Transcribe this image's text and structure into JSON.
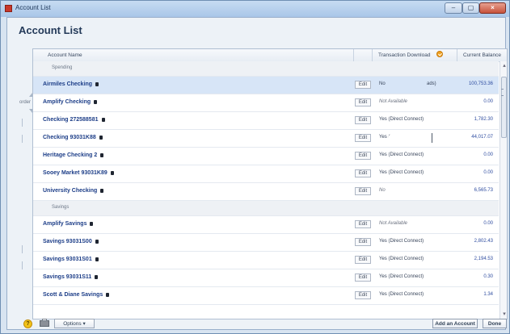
{
  "window": {
    "title": "Account List"
  },
  "page": {
    "title": "Account List"
  },
  "table": {
    "headers": {
      "name": "Account Name",
      "download": "Transaction Download",
      "balance": "Current Balance"
    },
    "edit_label": "Edit",
    "groups": [
      {
        "label": "Spending",
        "rows": [
          {
            "name": "Airmiles Checking",
            "download": "No",
            "download_extra": "ads)",
            "balance": "100,753.36",
            "selected": true
          },
          {
            "name": "Amplify Checking",
            "download": "Not Available",
            "balance": "0.00",
            "muted": true
          },
          {
            "name": "Checking 272588581",
            "download": "Yes (Direct Connect)",
            "balance": "1,782.30"
          },
          {
            "name": "Checking 93031K88",
            "download": "Yes (",
            "balance": "44,017.07",
            "cursor": true
          },
          {
            "name": "Heritage Checking 2",
            "download": "Yes (Direct Connect)",
            "balance": "0.00"
          },
          {
            "name": "Sooey Market 93031K89",
            "download": "Yes (Direct Connect)",
            "balance": "0.00"
          },
          {
            "name": "University Checking",
            "download": "No",
            "balance": "6,565.73",
            "muted": true
          }
        ]
      },
      {
        "label": "Savings",
        "rows": [
          {
            "name": "Amplify Savings",
            "download": "Not Available",
            "balance": "0.00",
            "muted": true
          },
          {
            "name": "Savings 93031S00",
            "download": "Yes (Direct Connect)",
            "balance": "2,802.43"
          },
          {
            "name": "Savings 93031S01",
            "download": "Yes (Direct Connect)",
            "balance": "2,194.53"
          },
          {
            "name": "Savings 93031S11",
            "download": "Yes (Direct Connect)",
            "balance": "0.30"
          },
          {
            "name": "Scott & Diane Savings",
            "download": "Yes (Direct Connect)",
            "balance": "1.34"
          }
        ]
      }
    ]
  },
  "sidebar": {
    "order_label": "order"
  },
  "footer": {
    "options_label": "Options ▾",
    "add_account_label": "Add an Account",
    "done_label": "Done"
  }
}
